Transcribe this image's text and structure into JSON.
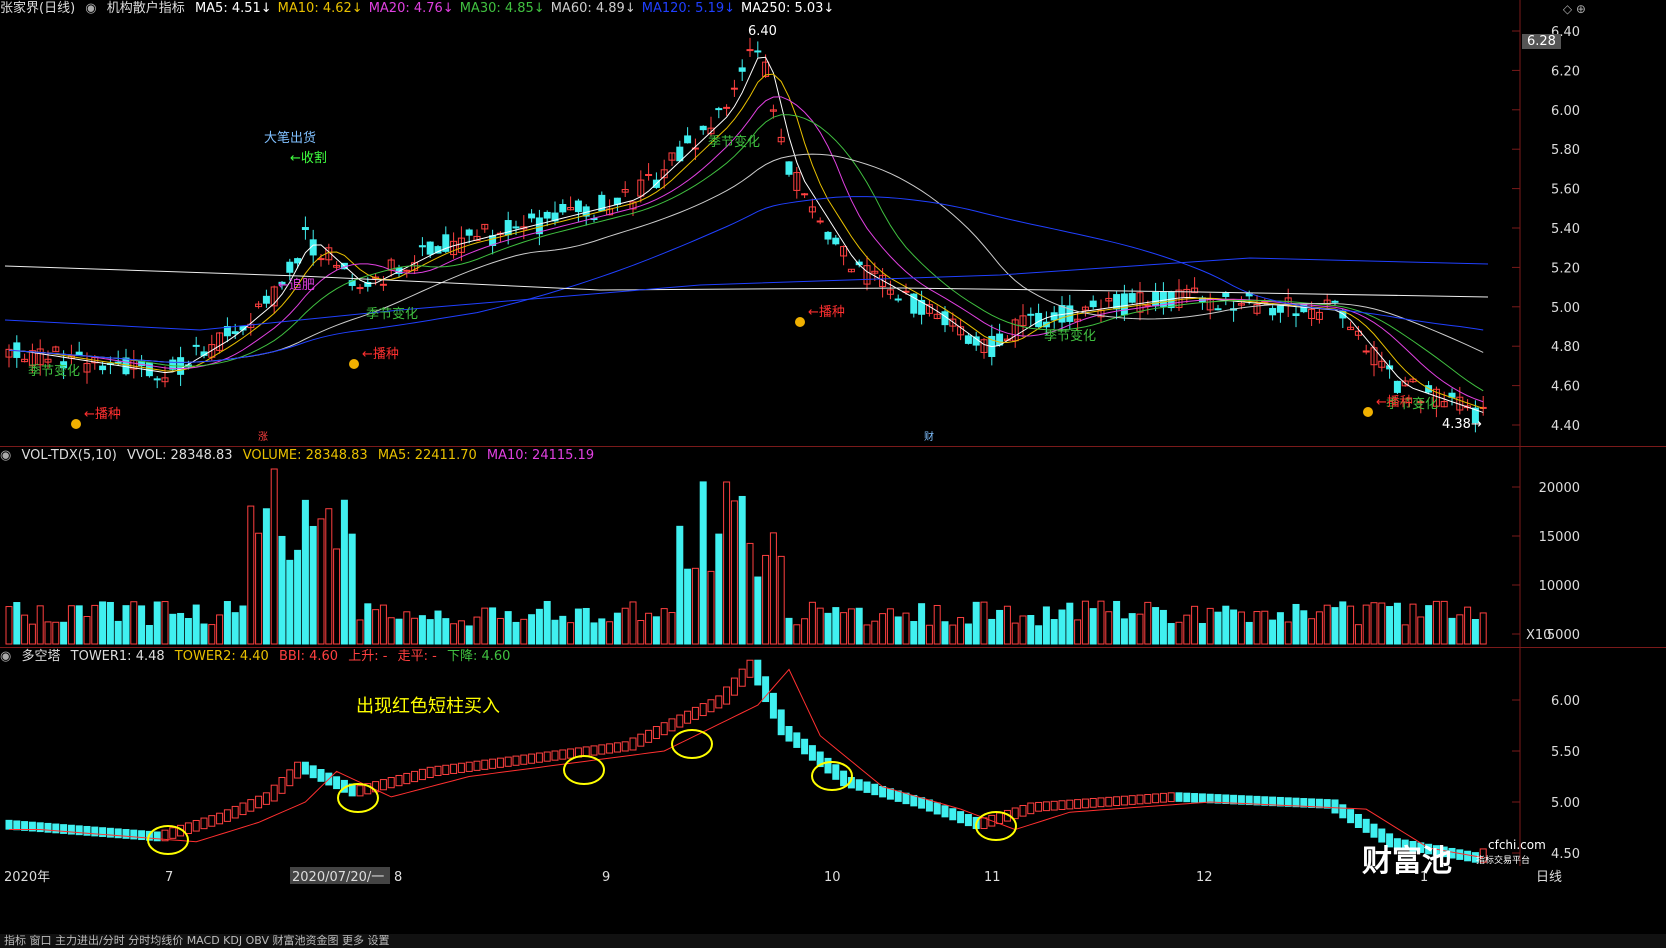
{
  "main": {
    "stock": "张家界(日线)",
    "indicator": "机构散户指标",
    "ma": [
      {
        "label": "MA5: 4.51",
        "color": "#ffffff"
      },
      {
        "label": "MA10: 4.62",
        "color": "#e8c000"
      },
      {
        "label": "MA20: 4.76",
        "color": "#e040e0"
      },
      {
        "label": "MA30: 4.85",
        "color": "#40c040"
      },
      {
        "label": "MA60: 4.89",
        "color": "#cccccc"
      },
      {
        "label": "MA120: 5.19",
        "color": "#2040ff"
      },
      {
        "label": "MA250: 5.03",
        "color": "#ffffff"
      }
    ],
    "price_ticks": [
      "6.40",
      "6.20",
      "6.00",
      "5.80",
      "5.60",
      "5.40",
      "5.20",
      "5.00",
      "4.80",
      "4.60",
      "4.40"
    ],
    "current_price": "6.28",
    "high_label": "6.40",
    "low_label": "4.38",
    "annotations": {
      "big_sell": "大笔出货",
      "harvest": "收割",
      "chase": "追肥",
      "season_change": "季节变化",
      "sow": "播种",
      "zhang": "涨",
      "cai": "财"
    }
  },
  "volume": {
    "title": "VOL-TDX(5,10)",
    "vvol": "VVOL: 28348.83",
    "volume": "VOLUME: 28348.83",
    "ma5": "MA5: 22411.70",
    "ma10": "MA10: 24115.19",
    "ticks": [
      "20000",
      "15000",
      "10000",
      "5000"
    ],
    "unit": "X10"
  },
  "tower": {
    "title": "多空塔",
    "tower1": "TOWER1: 4.48",
    "tower2": "TOWER2: 4.40",
    "bbi": "BBI: 4.60",
    "up": "上升: -",
    "flat": "走平: -",
    "down": "下降: 4.60",
    "ticks": [
      "6.00",
      "5.50",
      "5.00",
      "4.50"
    ],
    "note": "出现红色短柱买入"
  },
  "x_axis": {
    "labels": [
      "2020年",
      "7",
      "2020/07/20/一",
      "8",
      "9",
      "10",
      "11",
      "12",
      "1"
    ],
    "period": "日线"
  },
  "watermark": {
    "brand": "财富池",
    "site": "cfchi.com",
    "slogan": "指标交易平台"
  },
  "bottom_bar": {
    "text": "指标 窗口 主力进出/分时 分时均线价 MACD KDJ OBV 财富池资金图 更多 设置"
  },
  "colors": {
    "up": "#ff4040",
    "down": "#40f0f0",
    "bg": "#000000",
    "grid": "#7a1a1a"
  }
}
